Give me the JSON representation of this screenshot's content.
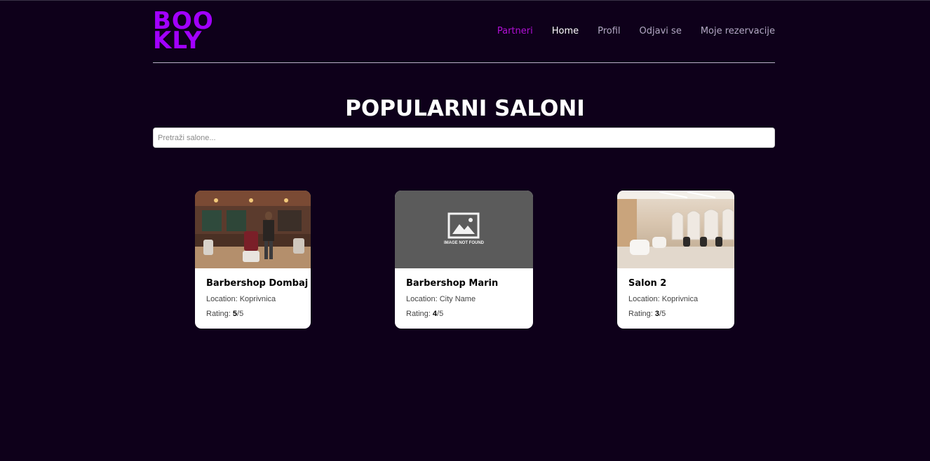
{
  "app": {
    "logo_line1": "BOO",
    "logo_line2": "KLY",
    "brand_color": "#a200ff"
  },
  "nav": {
    "items": [
      {
        "label": "Partneri"
      },
      {
        "label": "Home"
      },
      {
        "label": "Profil"
      },
      {
        "label": "Odjavi se"
      },
      {
        "label": "Moje rezervacije"
      }
    ]
  },
  "main": {
    "title": "POPULARNI SALONI",
    "search_placeholder": "Pretraži salone..."
  },
  "salons": [
    {
      "name": "Barbershop Dombaj",
      "location_label": "Location:",
      "location": "Koprivnica",
      "rating_label": "Rating:",
      "rating": "5",
      "rating_max": "/5",
      "image": "barbershop-photo"
    },
    {
      "name": "Barbershop Marin",
      "location_label": "Location:",
      "location": "City Name",
      "rating_label": "Rating:",
      "rating": "4",
      "rating_max": "/5",
      "image": "image-not-found",
      "image_text": "IMAGE NOT FOUND"
    },
    {
      "name": "Salon 2",
      "location_label": "Location:",
      "location": "Koprivnica",
      "rating_label": "Rating:",
      "rating": "3",
      "rating_max": "/5",
      "image": "salon-interior-photo"
    }
  ]
}
